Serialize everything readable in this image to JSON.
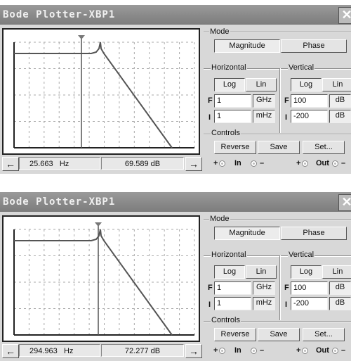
{
  "windows": [
    {
      "title": "Bode Plotter-XBP1",
      "close_icon": "close-x",
      "mode": {
        "label": "Mode",
        "magnitude": "Magnitude",
        "phase": "Phase",
        "selected": "Magnitude"
      },
      "horizontal": {
        "label": "Horizontal",
        "log": "Log",
        "lin": "Lin",
        "selected": "Log",
        "f_label": "F",
        "f_value": "1",
        "f_unit": "GHz",
        "i_label": "I",
        "i_value": "1",
        "i_unit": "mHz"
      },
      "vertical": {
        "label": "Vertical",
        "log": "Log",
        "lin": "Lin",
        "selected": "Log",
        "f_label": "F",
        "f_value": "100",
        "f_unit": "dB",
        "i_label": "I",
        "i_value": "-200",
        "i_unit": "dB"
      },
      "controls": {
        "label": "Controls",
        "reverse": "Reverse",
        "save": "Save",
        "set": "Set..."
      },
      "readout": {
        "frequency": "25.663",
        "freq_unit": "Hz",
        "magnitude": "69.589 dB"
      },
      "terminals": {
        "plus": "+",
        "minus": "–",
        "in": "In",
        "out": "Out"
      }
    },
    {
      "title": "Bode Plotter-XBP1",
      "close_icon": "close-x",
      "mode": {
        "label": "Mode",
        "magnitude": "Magnitude",
        "phase": "Phase",
        "selected": "Magnitude"
      },
      "horizontal": {
        "label": "Horizontal",
        "log": "Log",
        "lin": "Lin",
        "selected": "Log",
        "f_label": "F",
        "f_value": "1",
        "f_unit": "GHz",
        "i_label": "I",
        "i_value": "1",
        "i_unit": "mHz"
      },
      "vertical": {
        "label": "Vertical",
        "log": "Log",
        "lin": "Lin",
        "selected": "Log",
        "f_label": "F",
        "f_value": "100",
        "f_unit": "dB",
        "i_label": "I",
        "i_value": "-200",
        "i_unit": "dB"
      },
      "controls": {
        "label": "Controls",
        "reverse": "Reverse",
        "save": "Save",
        "set": "Set..."
      },
      "readout": {
        "frequency": "294.963",
        "freq_unit": "Hz",
        "magnitude": "72.277 dB"
      },
      "terminals": {
        "plus": "+",
        "minus": "–",
        "in": "In",
        "out": "Out"
      }
    }
  ],
  "colors": {
    "trace": "#555555",
    "grid": "#aaaaaa",
    "titlebar": "#8a8a8a",
    "window": "#d8d8d8"
  }
}
